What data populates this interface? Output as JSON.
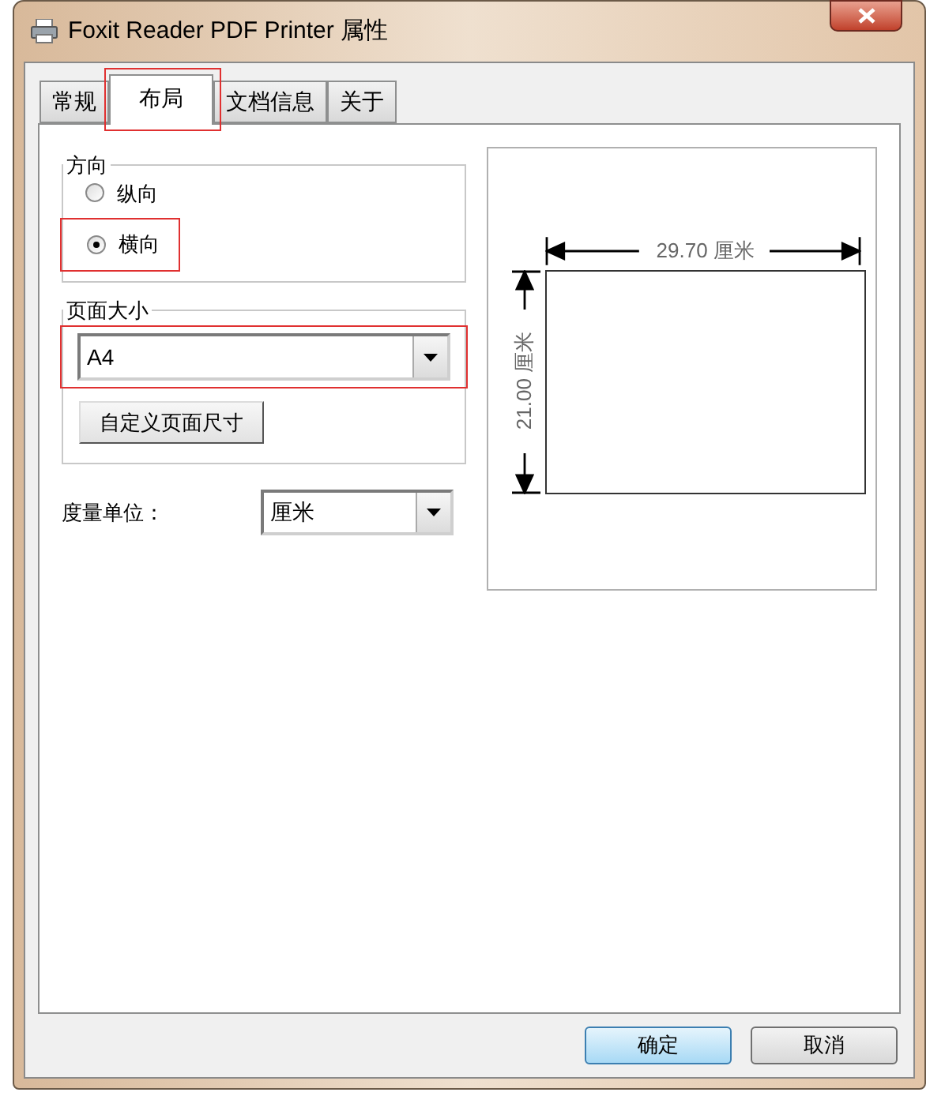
{
  "window": {
    "title": "Foxit Reader PDF Printer 属性"
  },
  "tabs": [
    {
      "label": "常规",
      "selected": false
    },
    {
      "label": "布局",
      "selected": true
    },
    {
      "label": "文档信息",
      "selected": false
    },
    {
      "label": "关于",
      "selected": false
    }
  ],
  "orientation": {
    "legend": "方向",
    "options": [
      {
        "label": "纵向",
        "selected": false
      },
      {
        "label": "横向",
        "selected": true
      }
    ]
  },
  "page_size": {
    "legend": "页面大小",
    "value": "A4",
    "custom_button": "自定义页面尺寸"
  },
  "unit": {
    "label": "度量单位：",
    "value": "厘米"
  },
  "preview": {
    "width_label": "29.70 厘米",
    "height_label": "21.00 厘米"
  },
  "buttons": [
    {
      "label": "确定",
      "kind": "default"
    },
    {
      "label": "取消",
      "kind": "normal"
    }
  ]
}
